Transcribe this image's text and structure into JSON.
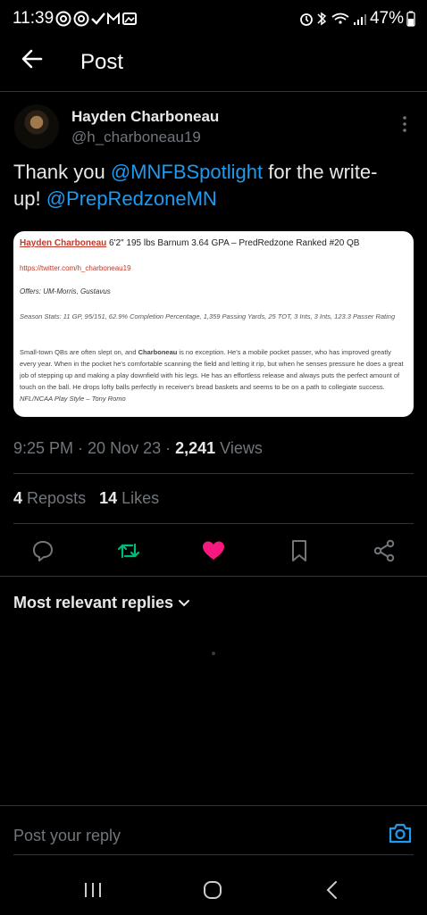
{
  "status_bar": {
    "time": "11:39",
    "battery": "47%"
  },
  "header": {
    "title": "Post"
  },
  "author": {
    "name": "Hayden Charboneau",
    "handle": "@h_charboneau19"
  },
  "post": {
    "text_1": "Thank you ",
    "mention_1": "@MNFBSpotlight",
    "text_2": " for the write-up! ",
    "mention_2": "@PrepRedzoneMN"
  },
  "card": {
    "name": "Hayden Charboneau",
    "headline_rest": " 6'2\" 195 lbs Barnum 3.64 GPA – PredRedzone Ranked #20 QB",
    "link": "https://twitter.com/h_charboneau19",
    "offers": "Offers: UM-Morris, Gustavus",
    "stats": "Season Stats: 11 GP, 95/151, 62.9% Completion Percentage, 1,359 Passing Yards, 25 TOT, 3 Ints, 3 Ints, 123.3 Passer Rating",
    "body_1": "Small-town QBs are often slept on, and ",
    "body_name": "Charboneau",
    "body_2": " is no exception. He's a mobile pocket passer, who has improved greatly every year. When in the pocket he's comfortable scanning the field and letting it rip, but when he senses pressure he does a great job of stepping up and making a play downfield with his legs. He has an effortless release and always puts the perfect amount of touch on the ball. He drops lofty balls perfectly in receiver's bread baskets and seems to be on a path to collegiate success. ",
    "body_style": "NFL/NCAA Play Style – Tony Romo"
  },
  "meta": {
    "time": "9:25 PM",
    "date": "20 Nov 23",
    "views_count": "2,241",
    "views_label": "Views"
  },
  "stats": {
    "reposts_count": "4",
    "reposts_label": "Reposts",
    "likes_count": "14",
    "likes_label": "Likes"
  },
  "actions": {
    "reply_icon": "speech-bubble-icon",
    "repost_icon": "repost-icon",
    "like_icon": "heart-icon",
    "bookmark_icon": "bookmark-icon",
    "share_icon": "share-icon",
    "repost_color": "#00ba7c",
    "like_color": "#f91880"
  },
  "replies": {
    "label": "Most relevant replies"
  },
  "reply_bar": {
    "placeholder": "Post your reply"
  },
  "colors": {
    "accent": "#1d9bf0",
    "background": "#000000",
    "muted": "#71767b"
  }
}
